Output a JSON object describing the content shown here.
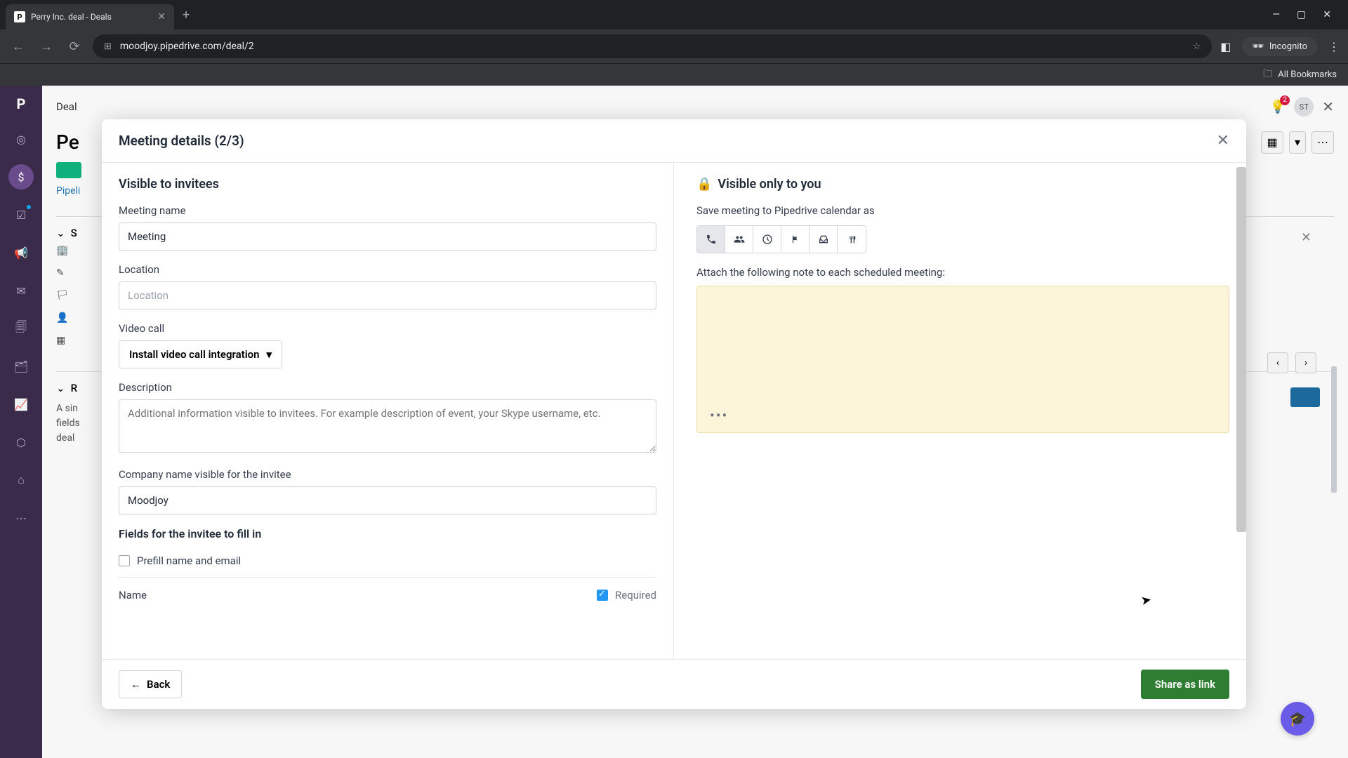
{
  "browser": {
    "tab_title": "Perry Inc. deal - Deals",
    "url": "moodjoy.pipedrive.com/deal/2",
    "incognito_label": "Incognito",
    "bookmarks_label": "All Bookmarks"
  },
  "background": {
    "deal_label": "Deal",
    "bulb_badge": "2",
    "avatar_initials": "ST",
    "title_prefix": "Pe",
    "pipeline_link": "Pipeli",
    "section_s": "S",
    "section_r": "R",
    "body_text": "A sin\nfields\ndeal"
  },
  "modal": {
    "title": "Meeting details (2/3)",
    "left": {
      "section_title": "Visible to invitees",
      "meeting_name_label": "Meeting name",
      "meeting_name_value": "Meeting",
      "location_label": "Location",
      "location_placeholder": "Location",
      "video_call_label": "Video call",
      "video_call_button": "Install video call integration",
      "description_label": "Description",
      "description_placeholder": "Additional information visible to invitees. For example description of event, your Skype username, etc.",
      "company_label": "Company name visible for the invitee",
      "company_value": "Moodjoy",
      "fields_section_title": "Fields for the invitee to fill in",
      "prefill_label": "Prefill name and email",
      "field_name": "Name",
      "required_label": "Required"
    },
    "right": {
      "section_title": "Visible only to you",
      "save_label": "Save meeting to Pipedrive calendar as",
      "note_label": "Attach the following note to each scheduled meeting:",
      "note_dots": "•••"
    },
    "footer": {
      "back": "Back",
      "share": "Share as link"
    }
  },
  "icons": {
    "call": "phone-icon",
    "people": "people-icon",
    "clock": "clock-icon",
    "flag": "flag-icon",
    "mail": "inbox-icon",
    "fork": "utensils-icon"
  }
}
